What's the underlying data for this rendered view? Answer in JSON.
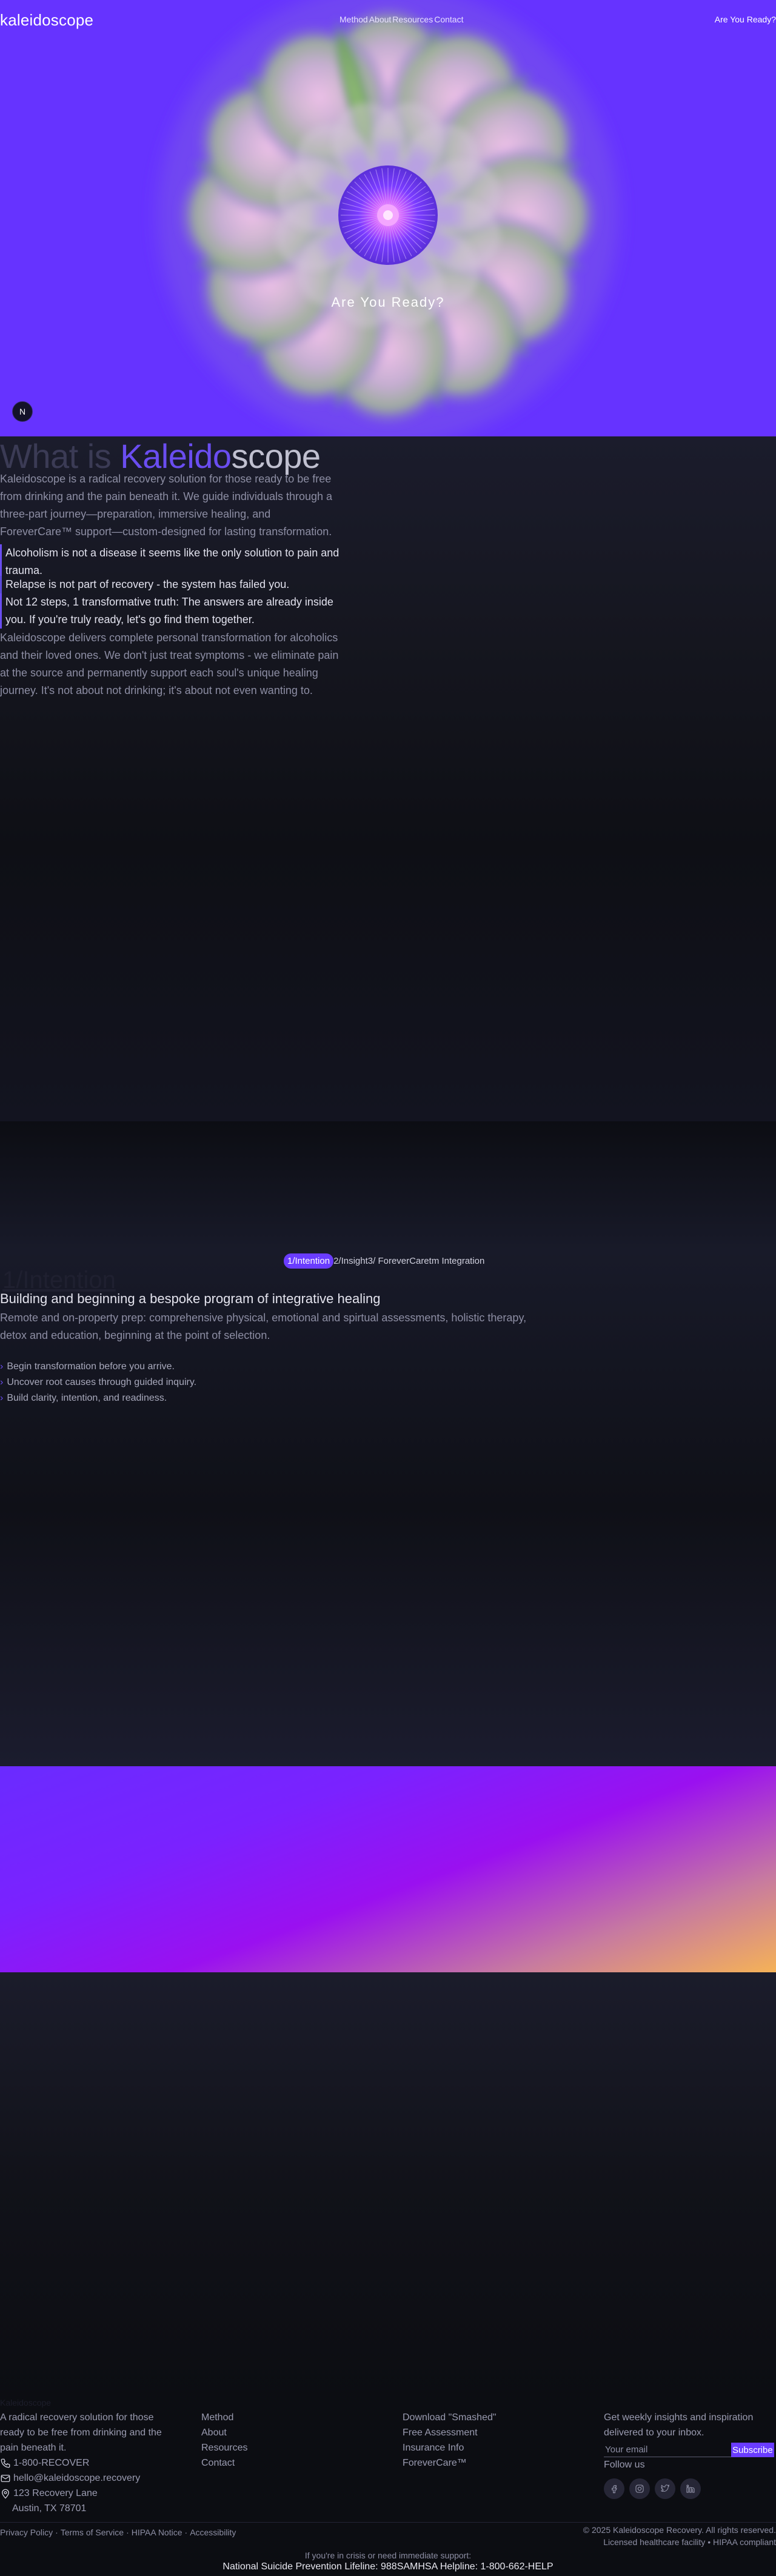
{
  "nav": {
    "logo": "kaleidoscope",
    "links": [
      "Method",
      "About",
      "Resources",
      "Contact"
    ],
    "cta": "Are You Ready?"
  },
  "hero": {
    "cta": "Are You Ready?",
    "avatar_initial": "N"
  },
  "about": {
    "title_part1": "What is ",
    "title_part2": "Kaleido",
    "title_part3": "scope",
    "lead": "Kaleidoscope is a radical recovery solution for those ready to be free from drinking and the pain beneath it. We guide individuals through a three-part journey—preparation, immersive healing, and ForeverCare™ support—custom-designed for lasting transformation.",
    "quote1": "Alcoholism is not a disease it seems like the only solution to pain and trauma.",
    "quote2": "Relapse is not part of recovery - the system has failed you.",
    "quote3": "Not 12 steps, 1 transformative truth: The answers are already inside you. If you're truly ready, let's go find them together.",
    "tail": "Kaleidoscope delivers complete personal transformation for alcoholics and their loved ones. We don't just treat symptoms - we eliminate pain at the source and permanently support each soul's unique healing journey. It's not about not drinking; it's about not even wanting to."
  },
  "method": {
    "tabs": [
      "1/Intention",
      "2/Insight",
      "3/ ForeverCaretm Integration"
    ],
    "big_title": "1/Intention",
    "subtitle": "Building and beginning a bespoke program of integrative healing",
    "description": "Remote and on-property prep: comprehensive physical, emotional and spirtual assessments, holistic therapy, detox and education, beginning at the point of selection.",
    "bullets": [
      "Begin transformation before you arrive.",
      "Uncover root causes through guided inquiry.",
      "Build clarity, intention, and readiness."
    ]
  },
  "footer": {
    "col1_heading": "Kaleidoscope",
    "col1_text": "A radical recovery solution for those ready to be free from drinking and the pain beneath it.",
    "phone": "1-800-RECOVER",
    "email": "hello@kaleidoscope.recovery",
    "address_line1": "123 Recovery Lane",
    "address_line2": "Austin, TX 78701",
    "col2_links": [
      "Method",
      "About",
      "Resources",
      "Contact"
    ],
    "col3_links": [
      "Download \"Smashed\"",
      "Free Assessment",
      "Insurance Info",
      "ForeverCare™"
    ],
    "newsletter_text": "Get weekly insights and inspiration delivered to your inbox.",
    "newsletter_placeholder": "Your email",
    "subscribe_label": "Subscribe",
    "follow_label": "Follow us",
    "legal_links": [
      "Privacy Policy",
      "Terms of Service",
      "HIPAA Notice",
      "Accessibility"
    ],
    "copyright_line1": "© 2025 Kaleidoscope Recovery. All rights reserved.",
    "copyright_line2": "Licensed healthcare facility • HIPAA compliant",
    "crisis_text": "If you're in crisis or need immediate support:",
    "hotlines": "National Suicide Prevention Lifeline: 988SAMHSA Helpline: 1-800-662-HELP"
  },
  "colors": {
    "accent": "#6a3cff",
    "hero_bg": "#6633ff",
    "band_start": "#6a2bff",
    "band_end": "#f5b257"
  },
  "icons": [
    "phone-icon",
    "mail-icon",
    "map-pin-icon",
    "facebook-icon",
    "instagram-icon",
    "twitter-icon",
    "linkedin-icon",
    "chevron-right-icon"
  ]
}
